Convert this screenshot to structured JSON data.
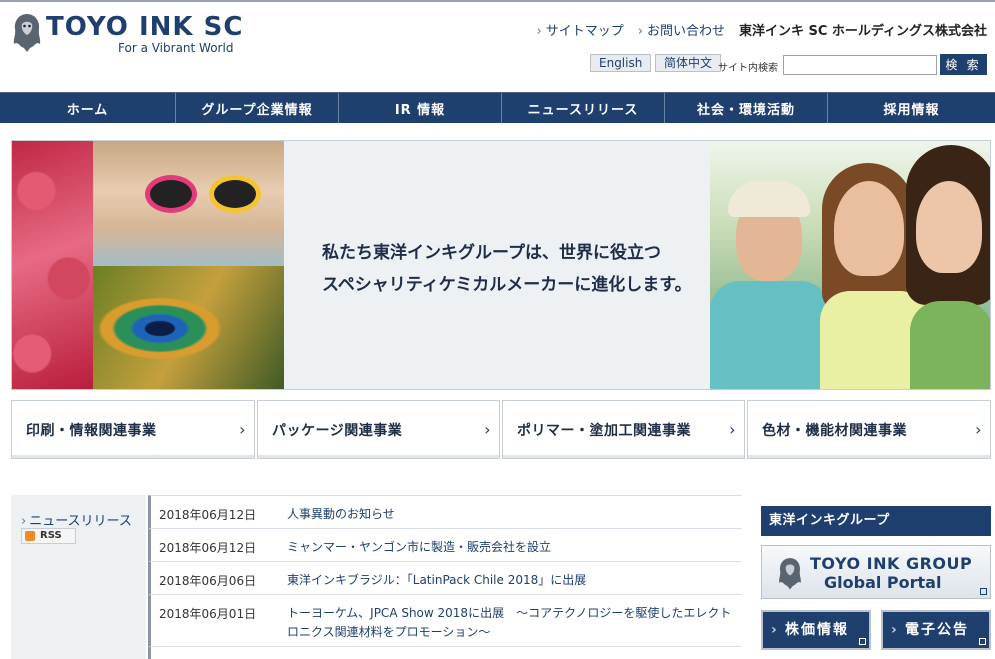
{
  "header": {
    "logo_name": "TOYO INK SC",
    "logo_tagline": "For a Vibrant World",
    "util_links": [
      "サイトマップ",
      "お問い合わせ"
    ],
    "corp_name": "東洋インキ SC ホールディングス株式会社",
    "lang_english": "English",
    "lang_chinese": "简体中文",
    "search_label": "サイト内検索",
    "search_value": "",
    "search_button": "検 索"
  },
  "nav": {
    "items": [
      "ホーム",
      "グループ企業情報",
      "IR 情報",
      "ニュースリリース",
      "社会・環境活動",
      "採用情報"
    ]
  },
  "hero": {
    "line1": "私たち東洋インキグループは、世界に役立つ",
    "line2": "スペシャリティケミカルメーカーに進化します。"
  },
  "categories": [
    "印刷・情報関連事業",
    "パッケージ関連事業",
    "ポリマー・塗加工関連事業",
    "色材・機能材関連事業"
  ],
  "news": {
    "heading": "ニュースリリース",
    "rss": "RSS",
    "items": [
      {
        "date": "2018年06月12日",
        "title": "人事異動のお知らせ"
      },
      {
        "date": "2018年06月12日",
        "title": "ミャンマー・ヤンゴン市に製造・販売会社を設立"
      },
      {
        "date": "2018年06月06日",
        "title": "東洋インキブラジル：「LatinPack Chile 2018」に出展"
      },
      {
        "date": "2018年06月01日",
        "title": "トーヨーケム、JPCA Show 2018に出展　～コアテクノロジーを駆使したエレクトロニクス関連材料をプロモーション～"
      }
    ]
  },
  "sidebar": {
    "group_heading": "東洋インキグループ",
    "portal_name": "TOYO INK GROUP",
    "portal_sub": "Global Portal",
    "stock_button": "株価情報",
    "notice_button": "電子公告"
  },
  "colors": {
    "navy": "#1f3f6e"
  }
}
